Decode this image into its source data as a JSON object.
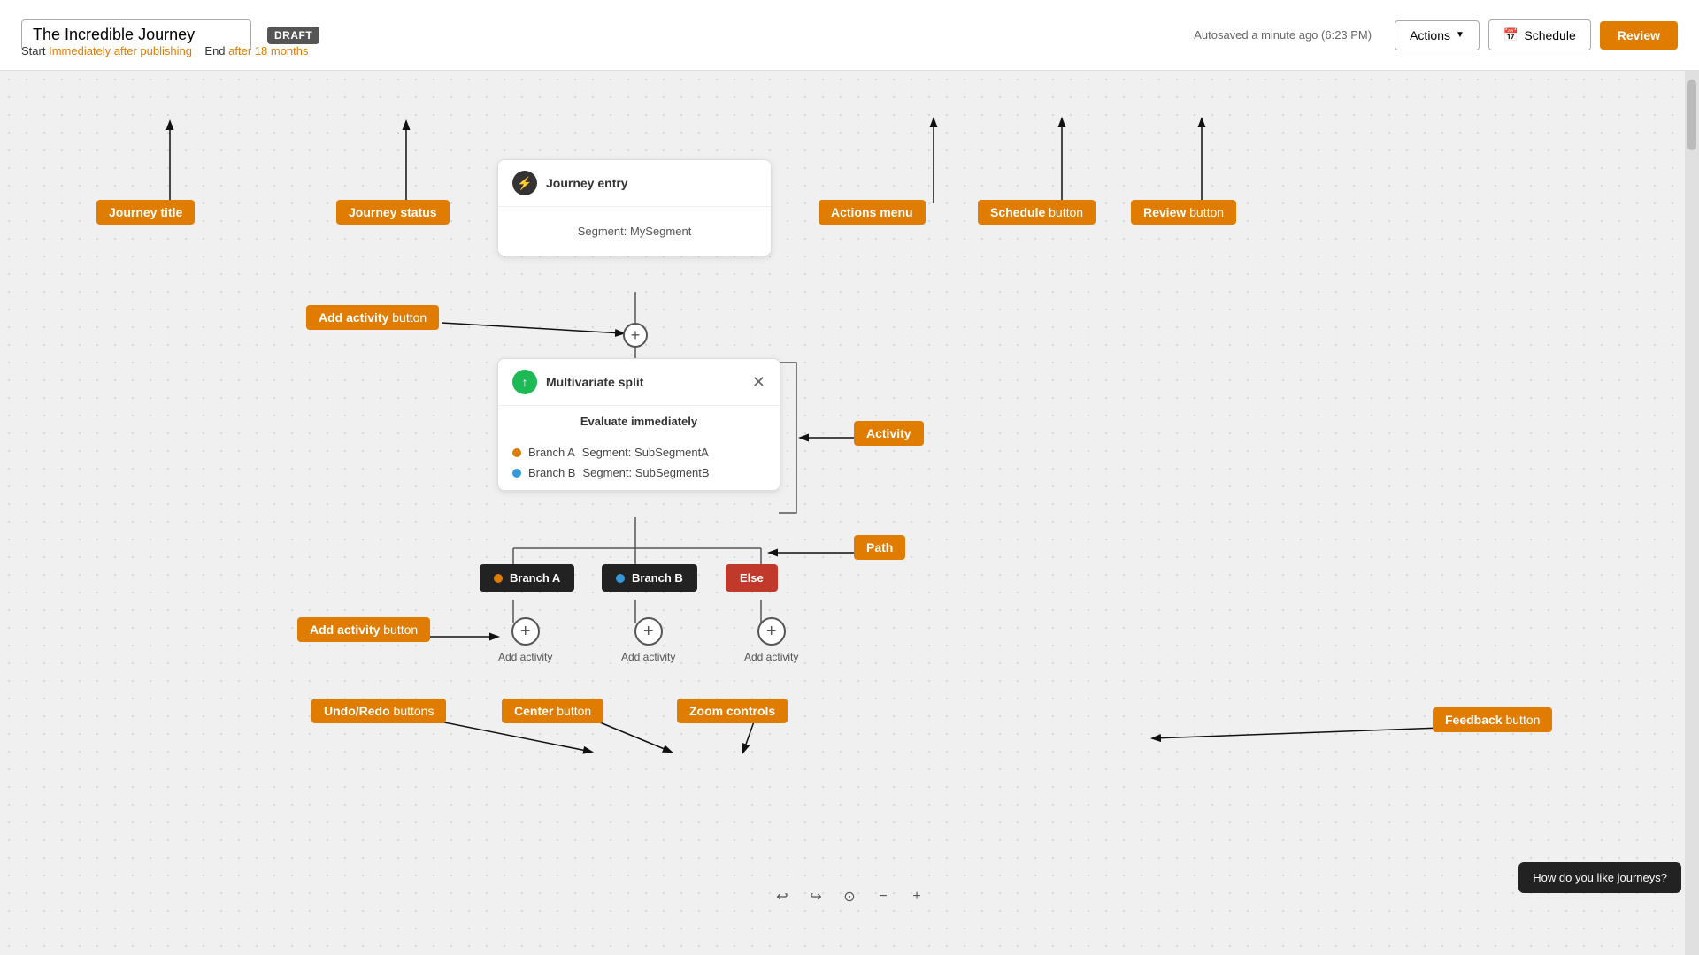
{
  "topbar": {
    "journey_title": "The Incredible Journey",
    "draft_label": "DRAFT",
    "start_label": "Start",
    "start_link": "Immediately after publishing",
    "end_label": "End",
    "end_link": "after 18 months",
    "autosave": "Autosaved a minute ago (6:23 PM)",
    "actions_label": "Actions",
    "schedule_label": "Schedule",
    "review_label": "Review"
  },
  "canvas": {
    "journey_entry_title": "Journey entry",
    "journey_entry_segment": "Segment: MySegment",
    "multivariate_title": "Multivariate split",
    "evaluate_label": "Evaluate immediately",
    "branch_a_label": "Branch A",
    "branch_a_segment": "Segment: SubSegmentA",
    "branch_b_label": "Branch B",
    "branch_b_segment": "Segment: SubSegmentB",
    "else_label": "Else",
    "add_activity_label": "Add activity",
    "branch_a_dot_color": "#e07c00",
    "branch_b_dot_color": "#3498db",
    "else_bg_color": "#c0392b"
  },
  "annotations": {
    "journey_title_label": "Journey title",
    "journey_status_label": "Journey status",
    "actions_menu_label": "Actions menu",
    "schedule_button_label": "Schedule button",
    "review_button_label": "Review button",
    "add_activity_top_label": "Add activity button",
    "activity_label": "Activity",
    "path_label": "Path",
    "add_activity_bottom_label": "Add activity button",
    "undo_redo_label": "Undo/Redo buttons",
    "center_label": "Center button",
    "zoom_label": "Zoom controls",
    "feedback_label": "Feedback button"
  },
  "feedback": {
    "tooltip": "How do you like journeys?"
  },
  "toolbar": {
    "undo_icon": "↩",
    "redo_icon": "↪",
    "center_icon": "⊙",
    "zoom_out_icon": "−",
    "zoom_in_icon": "+"
  }
}
